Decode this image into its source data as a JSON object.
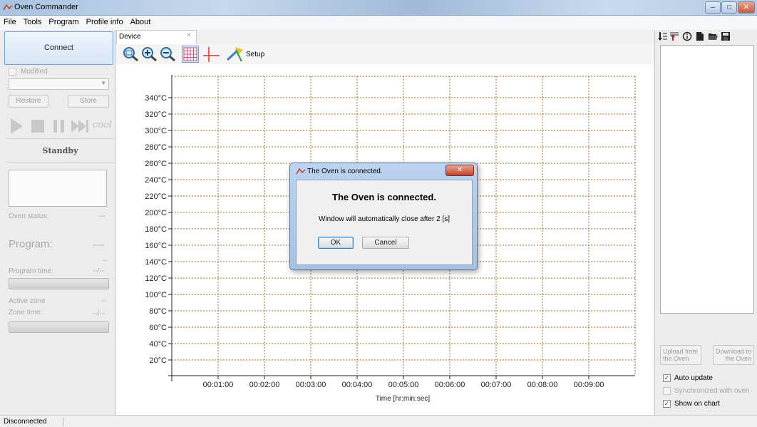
{
  "window": {
    "title": "Oven Commander",
    "controls": {
      "minimize": "–",
      "maximize": "□",
      "close": "✕"
    }
  },
  "menu": [
    "File",
    "Tools",
    "Program",
    "Profile info",
    "About"
  ],
  "left": {
    "connect_label": "Connect",
    "modified_label": "Modified",
    "restore_label": "Restore",
    "store_label": "Store",
    "cool_label": "cool",
    "state_label": "Standby",
    "oven_status_label": "Oven status:",
    "oven_status_value": "---",
    "program_label": "Program:",
    "program_value": "----",
    "program_sub_value": "--",
    "program_time_label": "Program time:",
    "program_time_value": "--/--",
    "active_zone_label": "Active zone",
    "active_zone_value": "--",
    "zone_time_label": "Zone time:",
    "zone_time_value": "--/--"
  },
  "tab": {
    "label": "Device",
    "close": "×"
  },
  "toolbar": {
    "setup_label": "Setup"
  },
  "chart_data": {
    "type": "line",
    "xlabel": "Time [hr:min:sec]",
    "ylabel": "",
    "yticks": [
      "340°C",
      "320°C",
      "300°C",
      "280°C",
      "260°C",
      "240°C",
      "220°C",
      "200°C",
      "180°C",
      "160°C",
      "140°C",
      "120°C",
      "100°C",
      "80°C",
      "60°C",
      "40°C",
      "20°C"
    ],
    "xticks": [
      "00:01:00",
      "00:02:00",
      "00:03:00",
      "00:04:00",
      "00:05:00",
      "00:06:00",
      "00:07:00",
      "00:08:00",
      "00:09:00"
    ],
    "ylim": [
      0,
      355
    ],
    "grid": true,
    "series": []
  },
  "right": {
    "upload_label_1": "Upload from",
    "upload_label_2": "the Oven",
    "download_label_1": "Download to",
    "download_label_2": "the Oven",
    "auto_update_label": "Auto update",
    "auto_update_checked": "✓",
    "synchronized_label": "Synchronized with oven",
    "show_on_chart_label": "Show on chart",
    "show_on_chart_checked": "✓"
  },
  "dialog": {
    "title": "The Oven is connected.",
    "heading": "The Oven is connected.",
    "message": "Window will automatically close after 2 [s]",
    "ok_label": "OK",
    "cancel_label": "Cancel",
    "close": "✕"
  },
  "status": {
    "text": "Disconnected"
  },
  "colors": {
    "grid": "#b5651d",
    "accent": "#1b3f8b"
  }
}
